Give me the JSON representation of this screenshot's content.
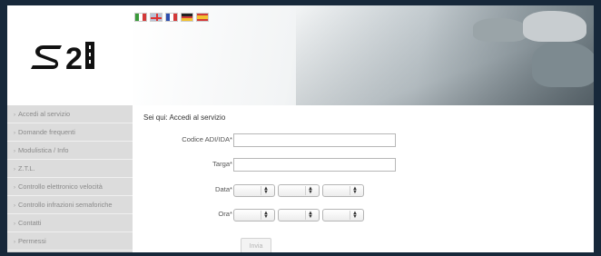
{
  "languages": [
    {
      "name": "italiano",
      "colors": [
        "#3a9a3a",
        "#ffffff",
        "#d33a3a"
      ]
    },
    {
      "name": "english",
      "colors": [
        "#b8c2d6"
      ]
    },
    {
      "name": "français",
      "colors": [
        "#2f4fae",
        "#ffffff",
        "#d33a3a"
      ]
    },
    {
      "name": "deutsch",
      "colors": [
        "#222222",
        "#d33a3a",
        "#f2c230"
      ]
    },
    {
      "name": "español",
      "colors": [
        "#d33a3a",
        "#f2c230",
        "#d33a3a"
      ]
    }
  ],
  "brand": {
    "logo_text": "S21",
    "logo_color": "#111111"
  },
  "sidebar": {
    "items": [
      {
        "label": "Accedi al servizio"
      },
      {
        "label": "Domande frequenti"
      },
      {
        "label": "Modulistica / Info"
      },
      {
        "label": "Z.T.L."
      },
      {
        "label": "Controllo elettronico velocità"
      },
      {
        "label": "Controllo infrazioni semaforiche"
      },
      {
        "label": "Contatti"
      },
      {
        "label": "Permessi"
      }
    ]
  },
  "main": {
    "breadcrumb": "Sei qui: Accedi al servizio",
    "form": {
      "codice_label": "Codice ADI/IDA*",
      "codice_value": "",
      "targa_label": "Targa*",
      "targa_value": "",
      "data_label": "Data*",
      "ora_label": "Ora*",
      "submit_label": "Invia"
    }
  }
}
